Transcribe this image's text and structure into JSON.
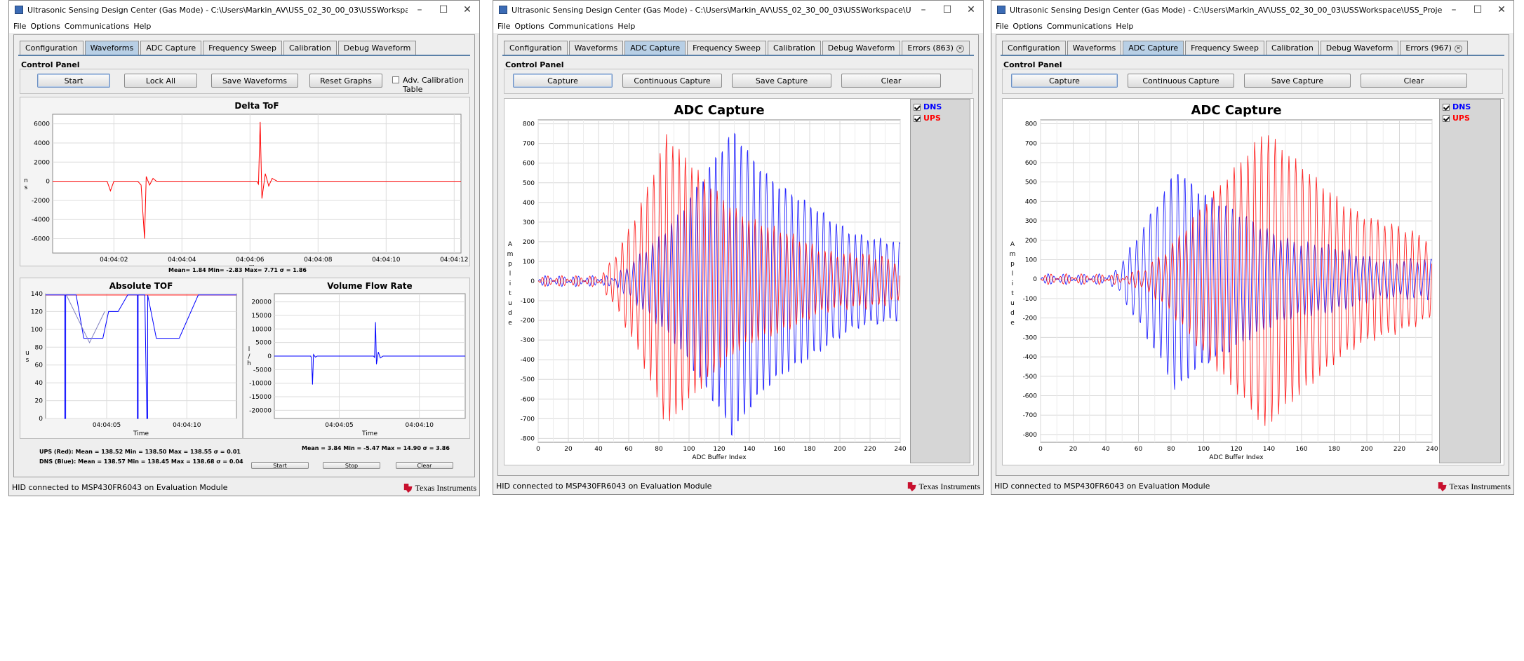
{
  "windows": [
    {
      "title": "Ultrasonic Sensing Design Center (Gas Mode) - C:\\Users\\Markin_AV\\USS_02_30_00_03\\USSWorkspace\\USS_Project",
      "menu": [
        "File",
        "Options",
        "Communications",
        "Help"
      ],
      "tabs": [
        "Configuration",
        "Waveforms",
        "ADC Capture",
        "Frequency Sweep",
        "Calibration",
        "Debug Waveform"
      ],
      "active_tab": "Waveforms",
      "control_panel_label": "Control Panel",
      "buttons": {
        "start": "Start",
        "lock_all": "Lock All",
        "save_waveforms": "Save Waveforms",
        "reset_graphs": "Reset Graphs"
      },
      "adv_calibration_label": "Adv. Calibration Table",
      "status": "HID connected to MSP430FR6043 on Evaluation Module",
      "logo_text": "Texas Instruments"
    },
    {
      "title": "Ultrasonic Sensing Design Center (Gas Mode) - C:\\Users\\Markin_AV\\USS_02_30_00_03\\USSWorkspace\\USS_Project",
      "menu": [
        "File",
        "Options",
        "Communications",
        "Help"
      ],
      "tabs": [
        "Configuration",
        "Waveforms",
        "ADC Capture",
        "Frequency Sweep",
        "Calibration",
        "Debug Waveform",
        "Errors (863)"
      ],
      "active_tab": "ADC Capture",
      "control_panel_label": "Control Panel",
      "buttons": {
        "capture": "Capture",
        "continuous": "Continuous Capture",
        "save": "Save Capture",
        "clear": "Clear"
      },
      "status": "HID connected to MSP430FR6043 on Evaluation Module",
      "logo_text": "Texas Instruments"
    },
    {
      "title": "Ultrasonic Sensing Design Center (Gas Mode) - C:\\Users\\Markin_AV\\USS_02_30_00_03\\USSWorkspace\\USS_Project",
      "menu": [
        "File",
        "Options",
        "Communications",
        "Help"
      ],
      "tabs": [
        "Configuration",
        "Waveforms",
        "ADC Capture",
        "Frequency Sweep",
        "Calibration",
        "Debug Waveform",
        "Errors (967)"
      ],
      "active_tab": "ADC Capture",
      "control_panel_label": "Control Panel",
      "buttons": {
        "capture": "Capture",
        "continuous": "Continuous Capture",
        "save": "Save Capture",
        "clear": "Clear"
      },
      "status": "HID connected to MSP430FR6043 on Evaluation Module",
      "logo_text": "Texas Instruments"
    }
  ],
  "waveforms_panel": {
    "delta_stats": "Mean= 1.84 Min= -2.83 Max= 7.71 σ = 1.86",
    "abs_stats_ups": "UPS (Red): Mean = 138.52 Min = 138.50 Max = 138.55 σ = 0.01",
    "abs_stats_dns": "DNS (Blue): Mean = 138.57 Min = 138.45 Max = 138.68 σ = 0.04",
    "vfr_stats": "Mean = 3.84 Min = -5.47 Max = 14.90 σ = 3.86",
    "vfr_buttons": [
      "Start",
      "Stop",
      "Clear"
    ]
  },
  "colors": {
    "ups": "#ff0000",
    "dns": "#0000ff",
    "tab_active": "#b8cfe5",
    "ti_red": "#c8102e"
  },
  "chart_data": [
    {
      "id": "delta-tof",
      "type": "line",
      "title": "Delta ToF",
      "xlabel": "Time",
      "ylabel": "ns",
      "xticks": [
        "04:04:02",
        "04:04:04",
        "04:04:06",
        "04:04:08",
        "04:04:10",
        "04:04:12"
      ],
      "xrange": [
        0,
        12
      ],
      "xtick_values": [
        1.8,
        3.8,
        5.8,
        7.8,
        9.8,
        11.8
      ],
      "ylim": [
        -7500,
        7000
      ],
      "yticks": [
        6000,
        4000,
        2000,
        0,
        -2000,
        -4000,
        -6000
      ],
      "series": [
        {
          "color": "#ff0000",
          "points": [
            [
              0,
              0
            ],
            [
              1.6,
              0
            ],
            [
              1.7,
              -1000
            ],
            [
              1.8,
              0
            ],
            [
              2.5,
              0
            ],
            [
              2.6,
              -400
            ],
            [
              2.7,
              -6000
            ],
            [
              2.75,
              500
            ],
            [
              2.85,
              -400
            ],
            [
              2.95,
              300
            ],
            [
              3.05,
              0
            ],
            [
              6.0,
              0
            ],
            [
              6.05,
              -300
            ],
            [
              6.1,
              6200
            ],
            [
              6.15,
              -1800
            ],
            [
              6.25,
              800
            ],
            [
              6.35,
              -500
            ],
            [
              6.45,
              300
            ],
            [
              6.6,
              0
            ],
            [
              12,
              0
            ]
          ]
        }
      ]
    },
    {
      "id": "absolute-tof",
      "type": "line",
      "title": "Absolute TOF",
      "xlabel": "Time",
      "ylabel": "us",
      "xticks": [
        "04:04:05",
        "04:04:10"
      ],
      "xrange": [
        0,
        10
      ],
      "xtick_values": [
        3.2,
        7.4
      ],
      "ylim": [
        0,
        140
      ],
      "yticks": [
        140,
        120,
        100,
        80,
        60,
        40,
        20,
        0
      ],
      "series": [
        {
          "color": "#ff0000",
          "points": [
            [
              0,
              138.5
            ],
            [
              10,
              138.5
            ]
          ]
        },
        {
          "color": "#0000ff",
          "points": [
            [
              0,
              138.6
            ],
            [
              1,
              138.6
            ],
            [
              1,
              0
            ],
            [
              1.05,
              0
            ],
            [
              1.05,
              138.6
            ],
            [
              1.6,
              138.6
            ],
            [
              1.6,
              138.6
            ],
            [
              2,
              90
            ],
            [
              2.5,
              90
            ],
            [
              3.0,
              90
            ],
            [
              3.3,
              120
            ],
            [
              3.8,
              120
            ],
            [
              4.3,
              138.6
            ],
            [
              4.8,
              138.6
            ],
            [
              4.8,
              0
            ],
            [
              4.85,
              0
            ],
            [
              4.85,
              138.6
            ],
            [
              5.2,
              138.6
            ],
            [
              5.3,
              0
            ],
            [
              5.35,
              0
            ],
            [
              5.35,
              138.6
            ],
            [
              5.8,
              90
            ],
            [
              7,
              90
            ],
            [
              8,
              138.6
            ],
            [
              10,
              138.6
            ]
          ]
        },
        {
          "color": "#8080c0",
          "points": [
            [
              1.1,
              138
            ],
            [
              2.3,
              85
            ],
            [
              3.1,
              120
            ]
          ]
        }
      ]
    },
    {
      "id": "volume-flow-rate",
      "type": "line",
      "title": "Volume Flow Rate",
      "xlabel": "Time",
      "ylabel": "l/h",
      "xticks": [
        "04:04:05",
        "04:04:10"
      ],
      "xrange": [
        0,
        10
      ],
      "xtick_values": [
        3.4,
        7.6
      ],
      "ylim": [
        -23000,
        23000
      ],
      "yticks": [
        20000,
        15000,
        10000,
        5000,
        0,
        -5000,
        -10000,
        -15000,
        -20000
      ],
      "series": [
        {
          "color": "#0000ff",
          "points": [
            [
              0,
              0
            ],
            [
              1.9,
              0
            ],
            [
              1.95,
              -700
            ],
            [
              2.0,
              -10500
            ],
            [
              2.05,
              600
            ],
            [
              2.15,
              -400
            ],
            [
              2.25,
              0
            ],
            [
              5.2,
              0
            ],
            [
              5.25,
              -500
            ],
            [
              5.3,
              12500
            ],
            [
              5.35,
              -3000
            ],
            [
              5.45,
              1500
            ],
            [
              5.55,
              -700
            ],
            [
              5.7,
              0
            ],
            [
              10,
              0
            ]
          ]
        }
      ]
    },
    {
      "id": "adc-capture-1",
      "type": "line",
      "title": "ADC Capture",
      "xlabel": "ADC Buffer Index",
      "ylabel": "Amplitude",
      "xlim": [
        0,
        240
      ],
      "xticks": [
        0,
        20,
        40,
        60,
        80,
        100,
        120,
        140,
        160,
        180,
        200,
        220,
        240
      ],
      "ylim": [
        -820,
        820
      ],
      "yticks": [
        800,
        700,
        600,
        500,
        400,
        300,
        200,
        100,
        0,
        -100,
        -200,
        -300,
        -400,
        -500,
        -600,
        -700,
        -800
      ],
      "legend": [
        "DNS",
        "UPS"
      ],
      "legend_position": "top-right",
      "series": [
        {
          "name": "DNS",
          "color": "#0000ff",
          "onset": 48,
          "peak_x": 128,
          "peak_amp": 750,
          "decay_end": 240,
          "period": 4.2,
          "phase": 1.3,
          "tail": 120
        },
        {
          "name": "UPS",
          "color": "#ff0000",
          "onset": 40,
          "peak_x": 84,
          "peak_amp": 720,
          "decay_end": 240,
          "period": 4.2,
          "phase": 0.0,
          "tail": 110
        }
      ]
    },
    {
      "id": "adc-capture-2",
      "type": "line",
      "title": "ADC Capture",
      "xlabel": "ADC Buffer Index",
      "ylabel": "Amplitude",
      "xlim": [
        0,
        240
      ],
      "xticks": [
        0,
        20,
        40,
        60,
        80,
        100,
        120,
        140,
        160,
        180,
        200,
        220,
        240
      ],
      "ylim": [
        -840,
        820
      ],
      "yticks": [
        800,
        700,
        600,
        500,
        400,
        300,
        200,
        100,
        0,
        -100,
        -200,
        -300,
        -400,
        -500,
        -600,
        -700,
        -800
      ],
      "legend": [
        "DNS",
        "UPS"
      ],
      "legend_position": "top-right",
      "series": [
        {
          "name": "DNS",
          "color": "#0000ff",
          "onset": 40,
          "peak_x": 82,
          "peak_amp": 560,
          "decay_end": 240,
          "period": 4.2,
          "phase": 1.3,
          "tail": 110
        },
        {
          "name": "UPS",
          "color": "#ff0000",
          "onset": 52,
          "peak_x": 136,
          "peak_amp": 760,
          "decay_end": 240,
          "period": 4.2,
          "phase": 0.0,
          "tail": 120
        }
      ]
    }
  ]
}
